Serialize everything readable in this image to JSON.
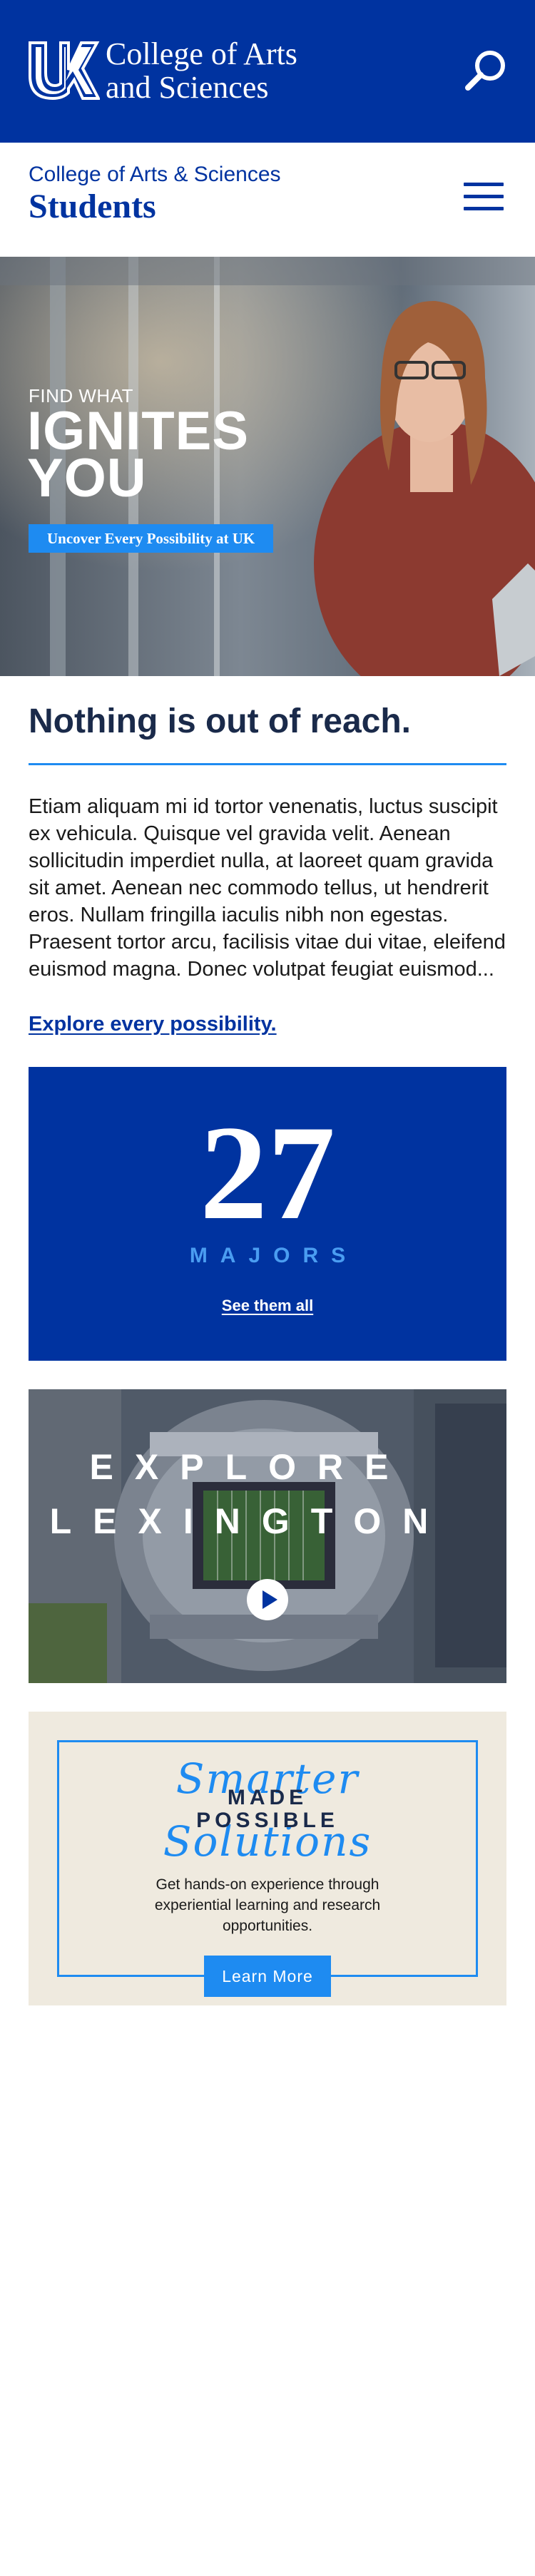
{
  "header": {
    "logo_text": "UK",
    "college_name_line1": "College of Arts",
    "college_name_line2": "and Sciences"
  },
  "subheader": {
    "college": "College of Arts & Sciences",
    "title": "Students"
  },
  "hero": {
    "kicker": "FIND WHAT",
    "title_line1": "IGNITES",
    "title_line2": "YOU",
    "cta": "Uncover Every Possibility at UK"
  },
  "intro": {
    "heading": "Nothing is out of reach.",
    "body": "Etiam aliquam mi id tortor venenatis, luctus suscipit ex vehicula. Quisque vel gravida velit. Aenean sollicitudin imperdiet nulla, at laoreet quam gravida sit amet. Aenean nec commodo tellus, ut hendrerit eros. Nullam fringilla iaculis nibh non egestas. Praesent tortor arcu, facilisis vitae dui vitae, eleifend euismod magna. Donec volutpat feugiat euismod...",
    "link": "Explore every possibility."
  },
  "majors": {
    "count": "27",
    "label": "MAJORS",
    "link": "See them all"
  },
  "lexington": {
    "line1": "EXPLORE",
    "line2": "LEXINGTON"
  },
  "smarter": {
    "script_top": "Smarter",
    "made": "MADE",
    "possible": "POSSIBLE",
    "script_bottom": "Solutions",
    "text": "Get hands-on experience through experiential learning and research opportunities.",
    "button": "Learn More"
  },
  "colors": {
    "uk_blue": "#0033a0",
    "accent_blue": "#1e8bf1",
    "cream": "#efeadf"
  }
}
